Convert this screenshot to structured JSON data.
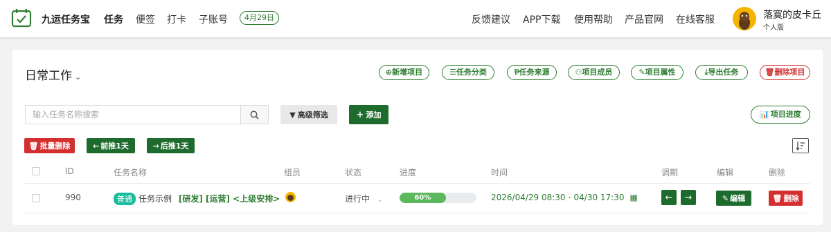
{
  "header": {
    "app_name": "九运任务宝",
    "nav": [
      "任务",
      "便签",
      "打卡",
      "子账号"
    ],
    "date_badge": "4月29日",
    "right_nav": [
      "反馈建议",
      "APP下载",
      "使用帮助",
      "产品官网",
      "在线客服"
    ],
    "user_name": "落寞的皮卡丘",
    "user_version": "个人版"
  },
  "project": {
    "title": "日常工作",
    "actions": [
      "新增项目",
      "任务分类",
      "任务来源",
      "项目成员",
      "项目属性",
      "导出任务",
      "删除项目"
    ]
  },
  "toolbar": {
    "search_placeholder": "输入任务名称搜索",
    "filter_label": "高级筛选",
    "add_label": "添加",
    "progress_label": "项目进度",
    "batch_delete": "批量删除",
    "shift_prev": "前推1天",
    "shift_next": "后推1天"
  },
  "table": {
    "headers": [
      "ID",
      "任务名称",
      "组员",
      "状态",
      "进度",
      "时间",
      "调期",
      "编辑",
      "删除"
    ],
    "rows": [
      {
        "id": "990",
        "tag": "普通",
        "name": "任务示例",
        "categories": "[研发] [运营] <上级安排>",
        "status": "进行中",
        "progress": 60,
        "progress_label": "60%",
        "time": "2026/04/29 08:30 - 04/30 17:30",
        "edit_label": "编辑",
        "delete_label": "删除"
      }
    ]
  },
  "colors": {
    "primary_green": "#1e6b2e",
    "danger_red": "#d32f2f",
    "progress_green": "#5cb85c",
    "tag_teal": "#1abc9c"
  }
}
